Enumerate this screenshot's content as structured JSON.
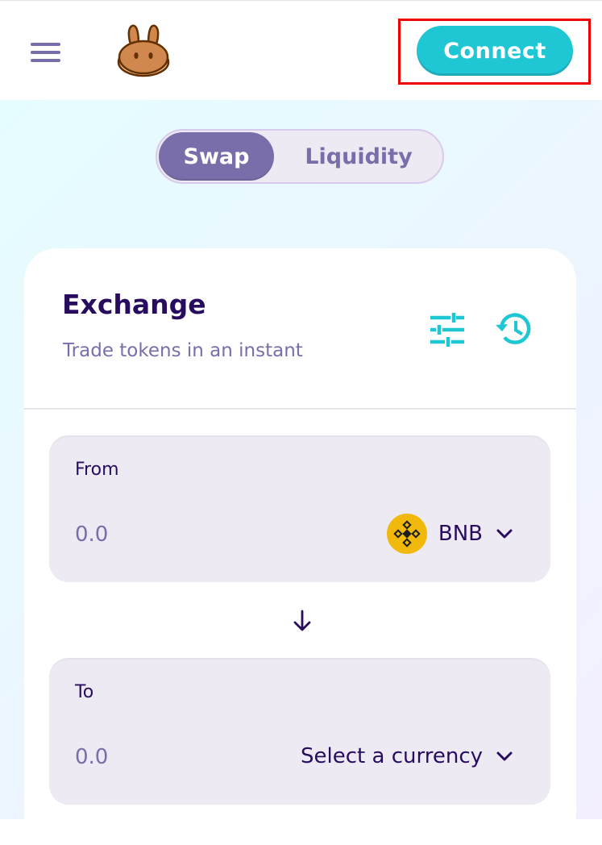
{
  "header": {
    "connect_label": "Connect",
    "logo_icon": "pancake-bunny-logo",
    "menu_icon": "hamburger-menu-icon"
  },
  "tabs": [
    {
      "label": "Swap",
      "active": true
    },
    {
      "label": "Liquidity",
      "active": false
    }
  ],
  "card": {
    "title": "Exchange",
    "subtitle": "Trade tokens in an instant",
    "icons": [
      "settings-sliders-icon",
      "history-clock-icon"
    ]
  },
  "from": {
    "label": "From",
    "placeholder": "0.0",
    "token": "BNB",
    "token_icon": "bnb-icon"
  },
  "to": {
    "label": "To",
    "placeholder": "0.0",
    "token": "Select a currency"
  },
  "colors": {
    "primary": "#1fc7d4",
    "secondary": "#7a6eaa",
    "text": "#280d5f",
    "input_bg": "#eeeaf4",
    "bnb_yellow": "#f0b90b",
    "highlight_box": "#ee0000"
  }
}
